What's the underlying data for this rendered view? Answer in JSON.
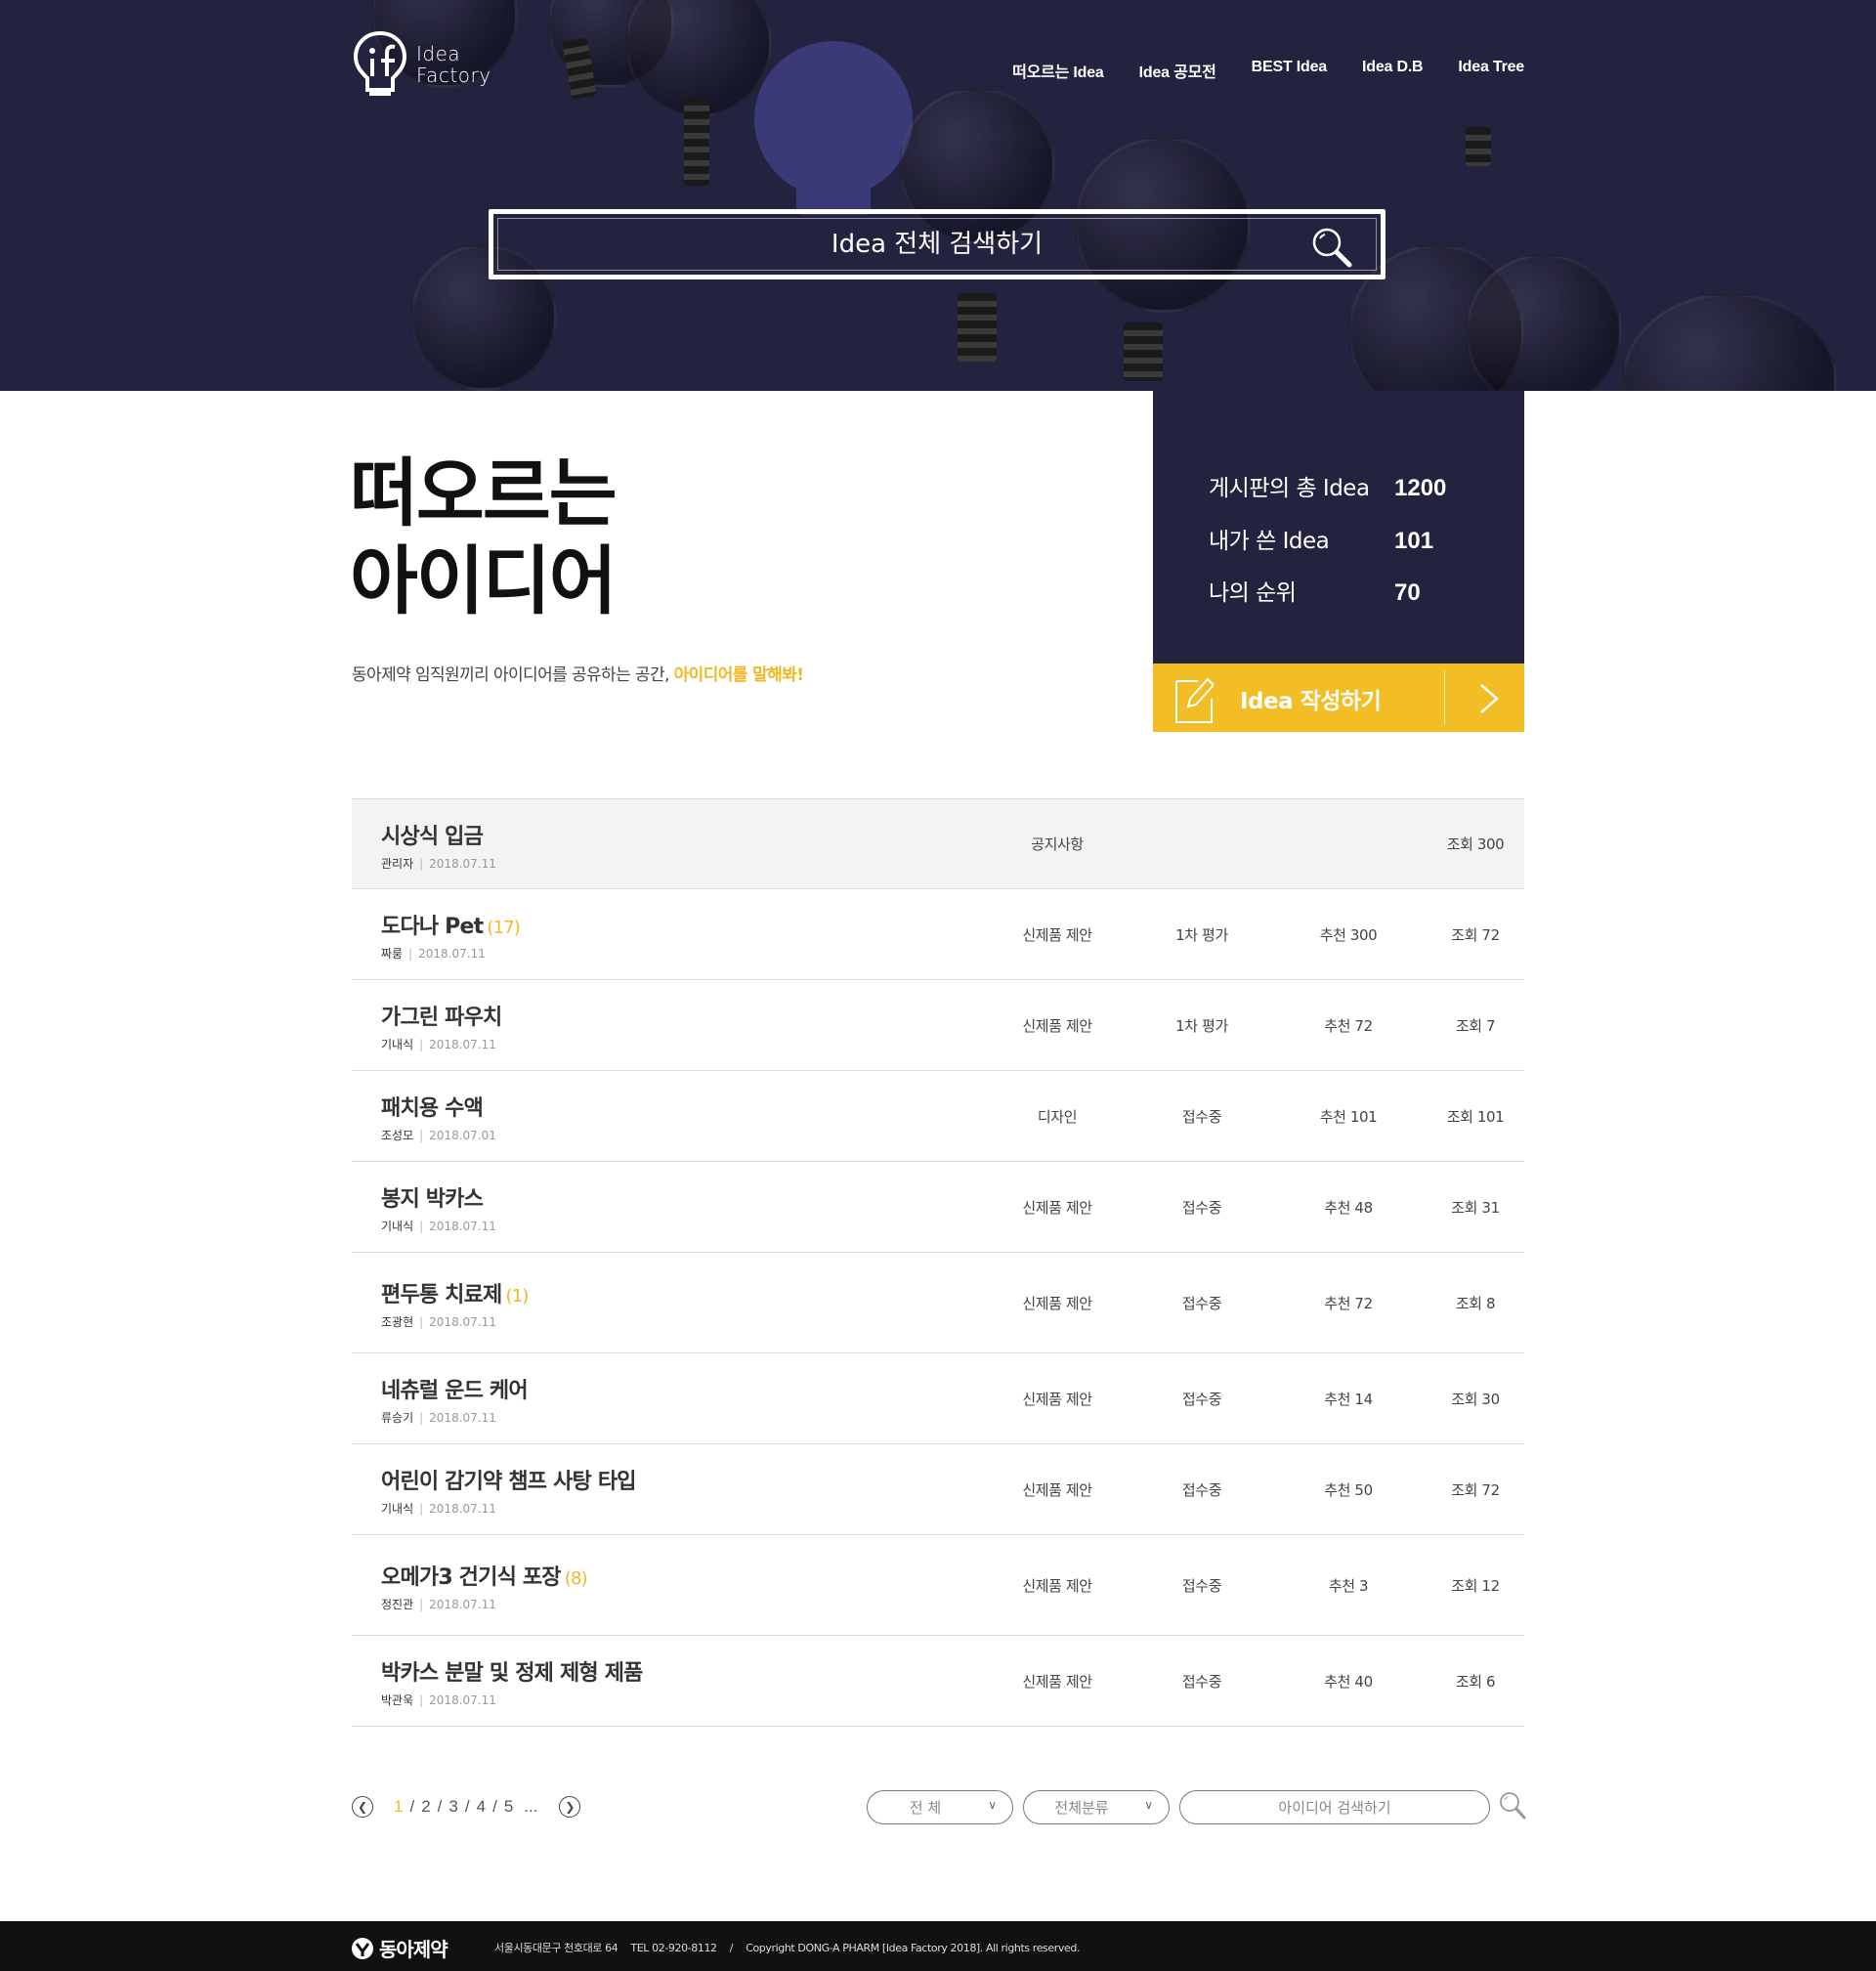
{
  "logo": {
    "line1": "Idea",
    "line2": "Factory"
  },
  "nav": [
    {
      "label": "떠오르는 Idea"
    },
    {
      "label": "Idea 공모전"
    },
    {
      "label": "BEST Idea"
    },
    {
      "label": "Idea D.B"
    },
    {
      "label": "Idea Tree"
    }
  ],
  "hero_search": {
    "placeholder": "Idea 전체 검색하기"
  },
  "page": {
    "title_line1": "떠오르는",
    "title_line2": "아이디어",
    "subtitle": "동아제약 임직원끼리 아이디어를 공유하는 공간, ",
    "subtitle_highlight": "아이디어를 말해봐!"
  },
  "stats": [
    {
      "label": "게시판의 총 Idea",
      "value": "1200"
    },
    {
      "label": "내가 쓴 Idea",
      "value": "101"
    },
    {
      "label": "나의 순위",
      "value": "70"
    }
  ],
  "write_button": {
    "label": "Idea 작성하기"
  },
  "notice": {
    "title": "시상식 입금",
    "author": "관리자",
    "date": "2018.07.11",
    "category": "공지사항",
    "views": "조회 300"
  },
  "ideas": [
    {
      "title": "도다나 Pet",
      "comments": "(17)",
      "author": "짜룽",
      "date": "2018.07.11",
      "category": "신제품 제안",
      "status": "1차 평가",
      "recommend": "추천 300",
      "views": "조회 72"
    },
    {
      "title": "가그린 파우치",
      "comments": "",
      "author": "기내식",
      "date": "2018.07.11",
      "category": "신제품 제안",
      "status": "1차 평가",
      "recommend": "추천 72",
      "views": "조회 7"
    },
    {
      "title": "패치용 수액",
      "comments": "",
      "author": "조성모",
      "date": "2018.07.01",
      "category": "디자인",
      "status": "접수중",
      "recommend": "추천 101",
      "views": "조회 101"
    },
    {
      "title": "봉지 박카스",
      "comments": "",
      "author": "기내식",
      "date": "2018.07.11",
      "category": "신제품 제안",
      "status": "접수중",
      "recommend": "추천 48",
      "views": "조회 31"
    },
    {
      "title": "편두통 치료제",
      "comments": "(1)",
      "author": "조광현",
      "date": "2018.07.11",
      "category": "신제품 제안",
      "status": "접수중",
      "recommend": "추천 72",
      "views": "조회 8"
    },
    {
      "title": "네츄럴 운드 케어",
      "comments": "",
      "author": "류승기",
      "date": "2018.07.11",
      "category": "신제품 제안",
      "status": "접수중",
      "recommend": "추천 14",
      "views": "조회 30"
    },
    {
      "title": "어린이 감기약 챔프 사탕 타입",
      "comments": "",
      "author": "기내식",
      "date": "2018.07.11",
      "category": "신제품 제안",
      "status": "접수중",
      "recommend": "추천 50",
      "views": "조회 72"
    },
    {
      "title": "오메가3 건기식 포장",
      "comments": "(8)",
      "author": "정진관",
      "date": "2018.07.11",
      "category": "신제품 제안",
      "status": "접수중",
      "recommend": "추천 3",
      "views": "조회 12"
    },
    {
      "title": "박카스 분말 및 정제 제형 제품",
      "comments": "",
      "author": "박관욱",
      "date": "2018.07.11",
      "category": "신제품 제안",
      "status": "접수중",
      "recommend": "추천 40",
      "views": "조회 6"
    }
  ],
  "pagination": {
    "pages": [
      "1",
      "2",
      "3",
      "4",
      "5"
    ],
    "current": "1",
    "ellipsis": "..."
  },
  "filters": {
    "scope": "전 체",
    "category": "전체분류",
    "search_placeholder": "아이디어 검색하기"
  },
  "footer": {
    "brand": "동아제약",
    "address": "서울시동대문구 천호대로 64",
    "tel": "TEL 02-920-8112",
    "divider": "/",
    "copyright": "Copyright DONG-A PHARM [Idea Factory 2018]. All rights reserved."
  },
  "colors": {
    "navy": "#23223f",
    "accent": "#f2bd25",
    "highlight": "#f2b823"
  }
}
